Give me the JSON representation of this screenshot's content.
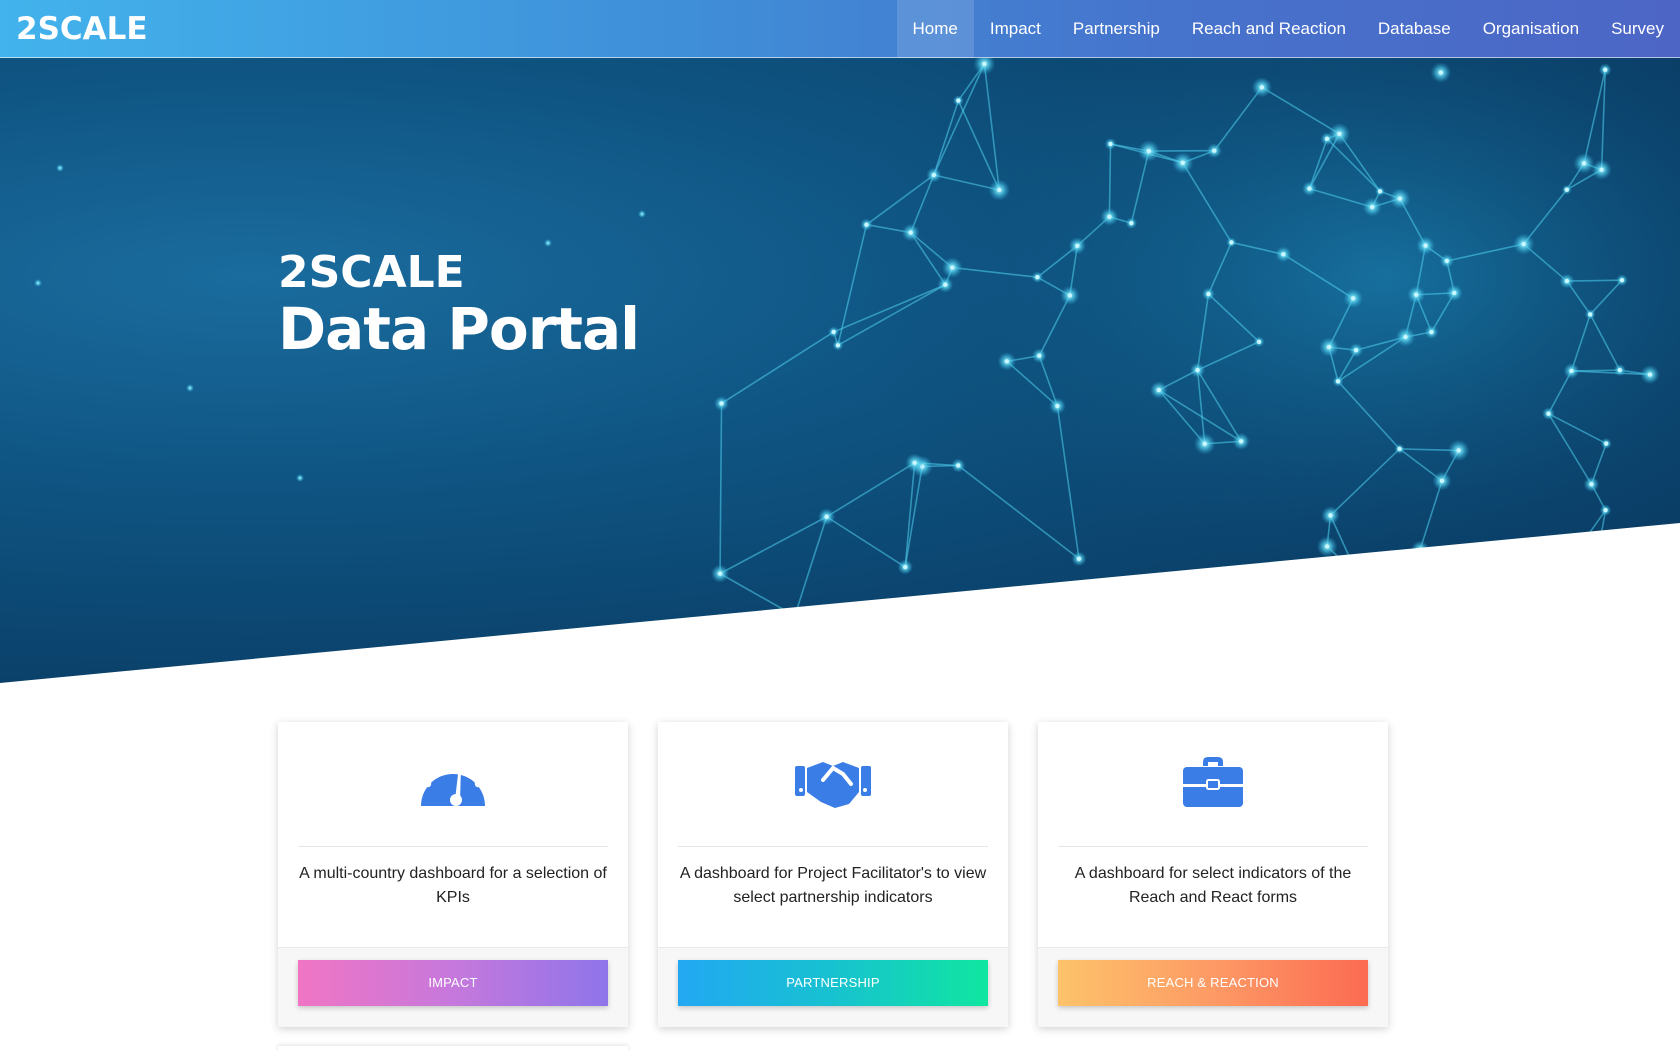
{
  "brand": {
    "name": "2SCALE"
  },
  "nav": {
    "items": [
      {
        "label": "Home",
        "active": true
      },
      {
        "label": "Impact"
      },
      {
        "label": "Partnership"
      },
      {
        "label": "Reach and Reaction"
      },
      {
        "label": "Database"
      },
      {
        "label": "Organisation"
      },
      {
        "label": "Survey"
      }
    ]
  },
  "hero": {
    "title_line1": "2SCALE",
    "title_line2": "Data Portal"
  },
  "cards": [
    {
      "icon": "speedometer-icon",
      "description": "A multi-country dashboard for a selection of KPIs",
      "button_label": "IMPACT"
    },
    {
      "icon": "handshake-icon",
      "description": "A dashboard for Project Facilitator's to view select partnership indicators",
      "button_label": "PARTNERSHIP"
    },
    {
      "icon": "briefcase-icon",
      "description": "A dashboard for select indicators of the Reach and React forms",
      "button_label": "REACH & REACTION"
    }
  ],
  "colors": {
    "nav_start": "#42b3ec",
    "nav_end": "#4d66c6",
    "hero_dark": "#093860",
    "icon_blue": "#3b7de6",
    "impact_start": "#f075c4",
    "impact_end": "#8f75ea",
    "partnership_start": "#22a8f3",
    "partnership_end": "#10e6a0",
    "reach_start": "#fdc36a",
    "reach_end": "#fb6b52"
  }
}
